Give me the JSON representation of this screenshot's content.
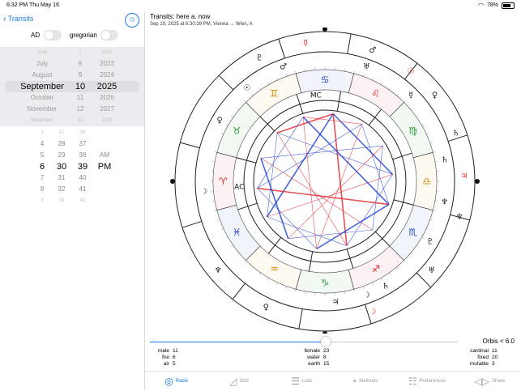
{
  "status": {
    "time": "6:32 PM",
    "date": "Thu May 16",
    "battery": "78%"
  },
  "nav": {
    "back_label": "Transits"
  },
  "toggles": {
    "ad_label": "AD",
    "gregorian_label": "gregorian"
  },
  "date_picker": {
    "months": [
      "June",
      "July",
      "August",
      "September",
      "October",
      "November",
      "December"
    ],
    "days": [
      "7",
      "8",
      "9",
      "10",
      "11",
      "12",
      "13"
    ],
    "years": [
      "2022",
      "2023",
      "2024",
      "2025",
      "2026",
      "2027",
      "2028"
    ]
  },
  "time_picker": {
    "hours": [
      "3",
      "4",
      "5",
      "6",
      "7",
      "8",
      "9"
    ],
    "minutes": [
      "27",
      "28",
      "29",
      "30",
      "31",
      "32",
      "33"
    ],
    "seconds": [
      "36",
      "37",
      "38",
      "39",
      "40",
      "41",
      "42"
    ],
    "ampm": [
      "AM",
      "PM"
    ]
  },
  "chart": {
    "title": "Transits: here a. now",
    "subtitle": "Sep 10, 2025 at 6:30:39 PM, Vienna → Wien, A",
    "colors": {
      "red": "#e0262b",
      "blue": "#1e3fd0",
      "green": "#2a9a3a",
      "orange": "#d88a00",
      "gray": "#999999"
    },
    "zodiac": [
      "♈",
      "♉",
      "♊",
      "♋",
      "♌",
      "♍",
      "♎",
      "♏",
      "♐",
      "♑",
      "♒",
      "♓"
    ],
    "angle_labels": {
      "mc": "MC",
      "ac": "AC"
    },
    "outer_planets": [
      "☿",
      "♇",
      "♂",
      "☉",
      "♀",
      "♄",
      "♃",
      "♆",
      "♅",
      "☽",
      "♆",
      "♀"
    ],
    "inner_planets": [
      "♀",
      "♂",
      "☽",
      "♄",
      "♃",
      "♅",
      "☽",
      "♆",
      "♇",
      "☿",
      "♄",
      "☉"
    ]
  },
  "orbis": {
    "label": "Orbis < 6.0",
    "fraction": 0.57
  },
  "stats": {
    "left": [
      {
        "k": "male",
        "v": "11"
      },
      {
        "k": "fire",
        "v": "6"
      },
      {
        "k": "air",
        "v": "5"
      }
    ],
    "middle": [
      {
        "k": "female",
        "v": "23"
      },
      {
        "k": "water",
        "v": "8"
      },
      {
        "k": "earth",
        "v": "15"
      }
    ],
    "right": [
      {
        "k": "cardinal",
        "v": "11"
      },
      {
        "k": "fixed",
        "v": "20"
      },
      {
        "k": "mutable",
        "v": "3"
      }
    ]
  },
  "tabs": [
    "Radix",
    "Grid",
    "Lists",
    "Methods",
    "Preferences",
    "Share"
  ],
  "tab_icons": [
    "radix-icon",
    "grid-icon",
    "lists-icon",
    "methods-icon",
    "preferences-icon",
    "share-icon"
  ]
}
